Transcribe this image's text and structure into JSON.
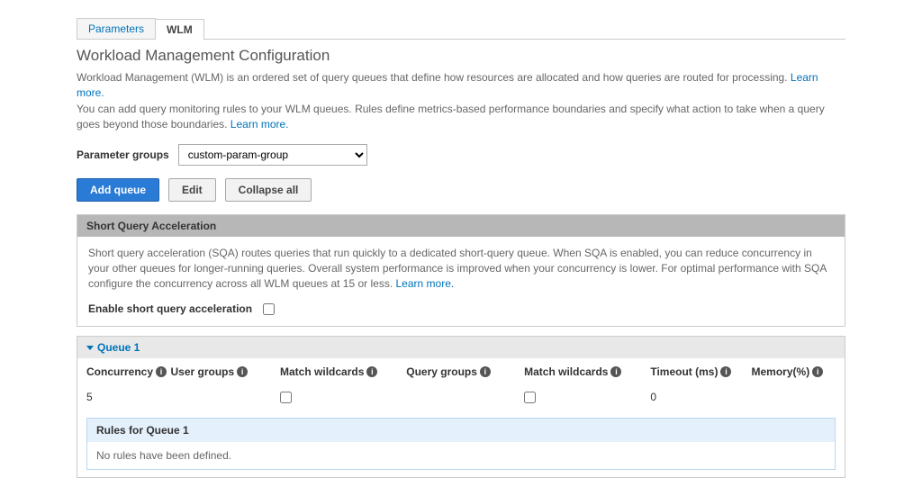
{
  "tabs": {
    "parameters": "Parameters",
    "wlm": "WLM"
  },
  "title": "Workload Management Configuration",
  "desc1a": "Workload Management (WLM) is an ordered set of query queues that define how resources are allocated and how queries are routed for processing. ",
  "desc1b": "You can add query monitoring rules to your WLM queues. Rules define metrics-based performance boundaries and specify what action to take when a query goes beyond those boundaries. ",
  "learn_more1": "Learn more.",
  "learn_more2": "Learn more.",
  "param_label": "Parameter groups",
  "param_value": "custom-param-group",
  "buttons": {
    "add": "Add queue",
    "edit": "Edit",
    "collapse": "Collapse all"
  },
  "sqa": {
    "title": "Short Query Acceleration",
    "body": "Short query acceleration (SQA) routes queries that run quickly to a dedicated short-query queue. When SQA is enabled, you can reduce concurrency in your other queues for longer-running queries. Overall system performance is improved when your concurrency is lower. For optimal performance with SQA configure the concurrency across all WLM queues at 15 or less. ",
    "learn": "Learn more.",
    "enable_label": "Enable short query acceleration"
  },
  "queue": {
    "name": "Queue 1",
    "headers": {
      "concurrency": "Concurrency",
      "user_groups": "User groups",
      "match_wild1": "Match wildcards",
      "query_groups": "Query groups",
      "match_wild2": "Match wildcards",
      "timeout": "Timeout (ms)",
      "memory": "Memory(%)"
    },
    "row": {
      "concurrency": "5",
      "timeout": "0"
    },
    "rules_title": "Rules for Queue 1",
    "rules_empty": "No rules have been defined."
  }
}
